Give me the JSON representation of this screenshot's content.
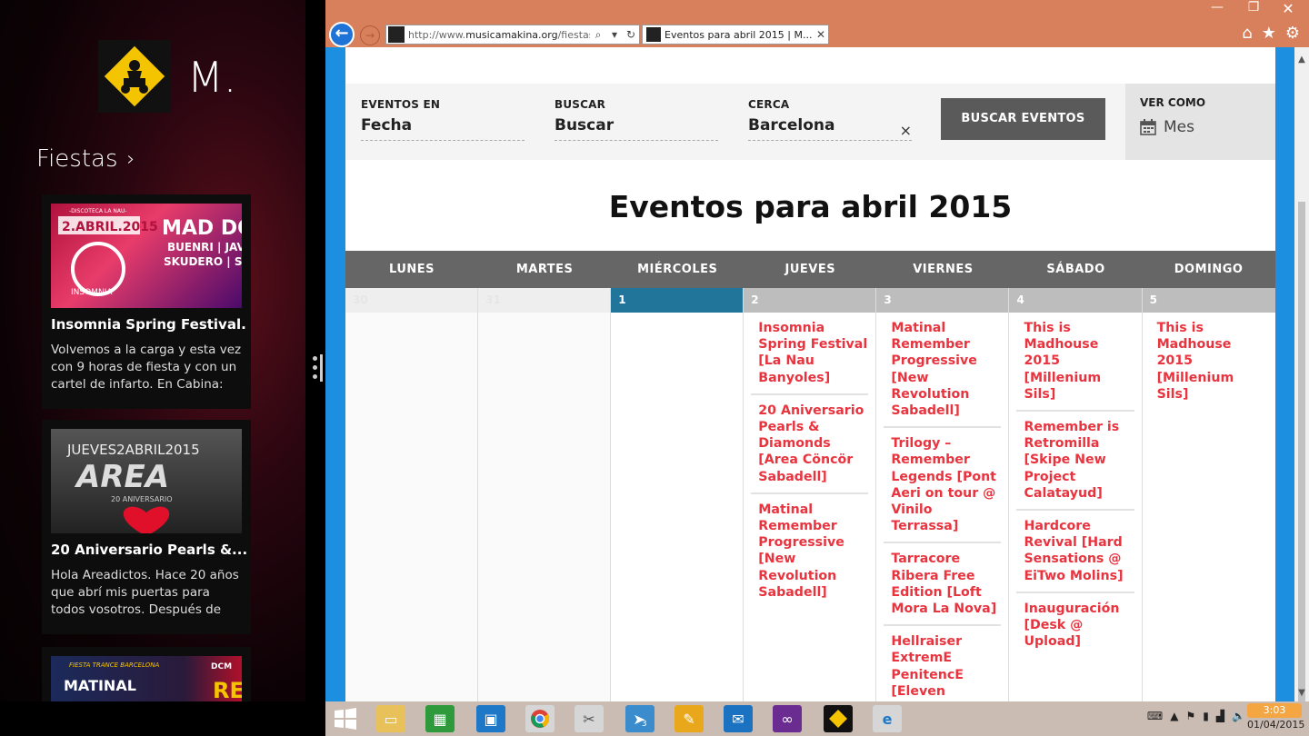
{
  "left_app": {
    "title": "M.",
    "section": "Fiestas",
    "cards": [
      {
        "title": "Insomnia Spring Festival...",
        "desc": "Volvemos a la carga y esta vez con 9 horas de fiesta y con un cartel de infarto. En Cabina: ►...",
        "poster": {
          "top": "-DISCOTECA LA NAU-",
          "date": "2.ABRIL.2015",
          "head": "MAD DOG",
          "l1": "BUENRI | JAVI M",
          "l2": "SKUDERO | SIS",
          "brand": "INSOMNIA"
        }
      },
      {
        "title": "20 Aniversario Pearls &...",
        "desc": "Hola Areadictos. Hace 20 años que abrí mis puertas para todos vosotros. Después de este largo...",
        "poster": {
          "date": "JUEVES2ABRIL2015",
          "head": "AREA",
          "sub": "20 ANIVERSARIO"
        }
      },
      {
        "title": "",
        "desc": "",
        "poster": {
          "top": "FIESTA TRANCE BARCELONA",
          "head": "MATINAL",
          "side": "DCM",
          "side2": "RE"
        }
      }
    ]
  },
  "browser": {
    "url_prefix": "http://www.",
    "url_domain": "musicamakina.org",
    "url_suffix": "/fiestas/",
    "tab_title": "Eventos para abril 2015 | M..."
  },
  "search": {
    "eventos_label": "EVENTOS EN",
    "eventos_value": "Fecha",
    "buscar_label": "BUSCAR",
    "buscar_value": "Buscar",
    "cerca_label": "CERCA",
    "cerca_value": "Barcelona",
    "clear": "×",
    "button": "BUSCAR EVENTOS",
    "ver_como_label": "VER COMO",
    "ver_como_value": "Mes"
  },
  "page_title": "Eventos para abril 2015",
  "calendar": {
    "days": [
      "LUNES",
      "MARTES",
      "MIÉRCOLES",
      "JUEVES",
      "VIERNES",
      "SÁBADO",
      "DOMINGO"
    ],
    "cells": [
      {
        "num": "30",
        "events": []
      },
      {
        "num": "31",
        "events": []
      },
      {
        "num": "1",
        "events": []
      },
      {
        "num": "2",
        "events": [
          "Insomnia Spring Festival [La Nau Banyoles]",
          "20 Aniversario Pearls & Diamonds [Area Cöncör Sabadell]",
          "Matinal Remember Progressive [New Revolution Sabadell]"
        ]
      },
      {
        "num": "3",
        "events": [
          "Matinal Remember Progressive [New Revolution Sabadell]",
          "Trilogy – Remember Legends [Pont Aeri on tour @ Vinilo Terrassa]",
          "Tarracore Ribera Free Edition [Loft Mora La Nova]",
          "Hellraiser ExtremE PenitencE [Eleven Vallgorguina]"
        ]
      },
      {
        "num": "4",
        "events": [
          "This is Madhouse 2015 [Millenium Sils]",
          "Remember is Retromilla [Skipe New Project Calatayud]",
          "Hardcore Revival [Hard Sensations @ EiTwo Molins]",
          "Inauguración [Desk @ Upload]"
        ]
      },
      {
        "num": "5",
        "events": [
          "This is Madhouse 2015 [Millenium Sils]"
        ]
      }
    ]
  },
  "taskbar": {
    "time": "3:03",
    "date": "01/04/2015",
    "badge": "3"
  },
  "colors": {
    "accent_blue": "#1c8fe0",
    "event_red": "#e8343f",
    "today_blue": "#21759b",
    "chrome_orange": "#d87f5b"
  }
}
